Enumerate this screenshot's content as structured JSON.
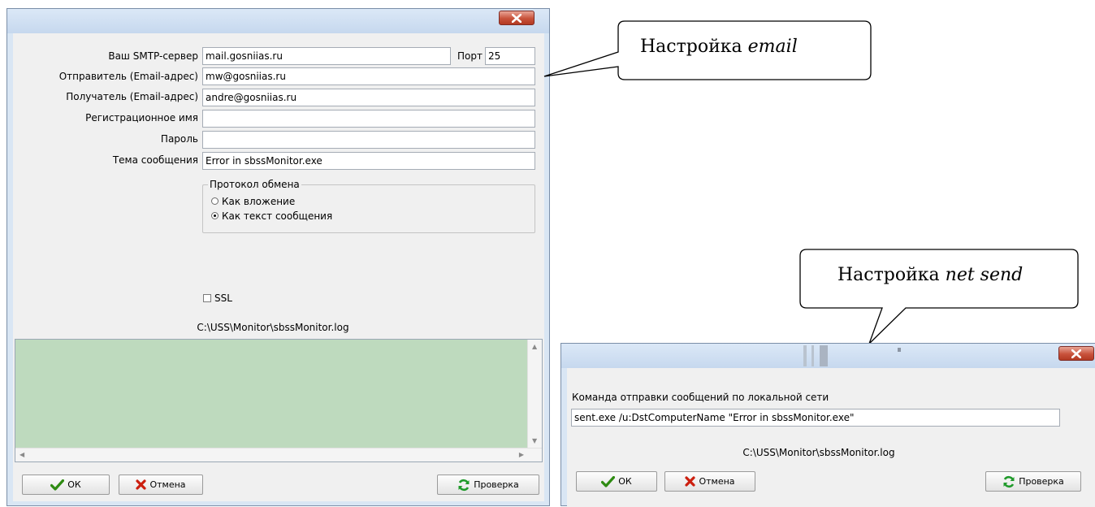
{
  "email_dialog": {
    "smtp_label": "Ваш SMTP-сервер",
    "smtp_value": "mail.gosniias.ru",
    "port_label": "Порт",
    "port_value": "25",
    "sender_label": "Отправитель (Email-адрес)",
    "sender_value": "mw@gosniias.ru",
    "recipient_label": "Получатель (Email-адрес)",
    "recipient_value": "andre@gosniias.ru",
    "login_label": "Регистрационное имя",
    "login_value": "",
    "password_label": "Пароль",
    "password_value": "",
    "subject_label": "Тема сообщения",
    "subject_value": "Error in sbssMonitor.exe",
    "protocol_group": "Протокол обмена",
    "protocol_options": [
      "Как вложение",
      "Как текст сообщения"
    ],
    "protocol_selected": 1,
    "ssl_label": "SSL",
    "log_path": "C:\\USS\\Monitor\\sbssMonitor.log",
    "ok_label": "ОК",
    "cancel_label": "Отмена",
    "check_label": "Проверка"
  },
  "netsend_dialog": {
    "command_label": "Команда отправки сообщений по локальной сети",
    "command_value": "sent.exe /u:DstComputerName \"Error in sbssMonitor.exe\"",
    "log_path": "C:\\USS\\Monitor\\sbssMonitor.log",
    "ok_label": "ОК",
    "cancel_label": "Отмена",
    "check_label": "Проверка"
  },
  "callouts": {
    "email_prefix": "Настройка",
    "email_em": "email",
    "netsend_prefix": "Настройка",
    "netsend_em": "net send"
  },
  "icons": {
    "close": "close-x-icon",
    "ok": "checkmark-icon",
    "cancel": "red-x-icon",
    "check": "refresh-arrows-icon"
  },
  "colors": {
    "log_background": "#bedabe",
    "close_button": "#c8523b",
    "titlebar": "#c6d8ee",
    "ok_check": "#2e8b12",
    "cancel_x": "#cc1f0f",
    "refresh": "#1f9a2a"
  }
}
